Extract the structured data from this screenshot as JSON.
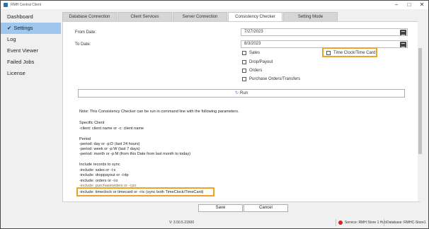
{
  "window": {
    "title": "RMH Central Client",
    "minimize": "–",
    "maximize": "□",
    "close": "✕"
  },
  "sidebar": {
    "items": [
      {
        "label": "Dashboard"
      },
      {
        "check": "✔",
        "label": "Settings",
        "active": true
      },
      {
        "label": "Log"
      },
      {
        "label": "Event Viewer"
      },
      {
        "label": "Failed Jobs"
      },
      {
        "label": "License"
      }
    ]
  },
  "tabs": [
    "Database Connection",
    "Client Services",
    "Server Connection",
    "Consistency Checker",
    "Setting Mode"
  ],
  "form": {
    "from_label": "From Date:",
    "from_value": "7/27/2023",
    "to_label": "To Date:",
    "to_value": "8/3/2023",
    "checkboxes": {
      "sales": "Sales",
      "drop_payout": "Drop/Payout",
      "orders": "Orders",
      "purchase_orders": "Purchase Orders/Transfers",
      "time_clock": "Time Clock/Time Card"
    },
    "run_icon": "↻",
    "run_label": "Run"
  },
  "notes": [
    "Note: This Consistency Checker can be run in command line with the following parameters.",
    "",
    "Specific Client",
    "-client: client name or -c: client name",
    "",
    "Period",
    "-period: day or -p:D (last 24 hours)",
    "-period: week or -p:W (last 7 days)",
    "-period: month or -p:M (from this Date from last month to today)",
    "",
    "Include records to sync",
    "-include: sales or -i:s",
    "-include: droppayout or -i:dp",
    "-include: orders or -i:o",
    "-include: purchaseorders or -i:po",
    "-include: timeclock or timecard or -i:tc (sync both TimeClock/TimeCard)"
  ],
  "actions": {
    "save": "Save",
    "cancel": "Cancel"
  },
  "status": {
    "version": "V: 3.50.5.21500",
    "service": "Service: RMH Store 1 Hub",
    "database": "Database: RMHC-Store1",
    "service_color": "#e02020"
  },
  "highlight_color": "#e8a623"
}
